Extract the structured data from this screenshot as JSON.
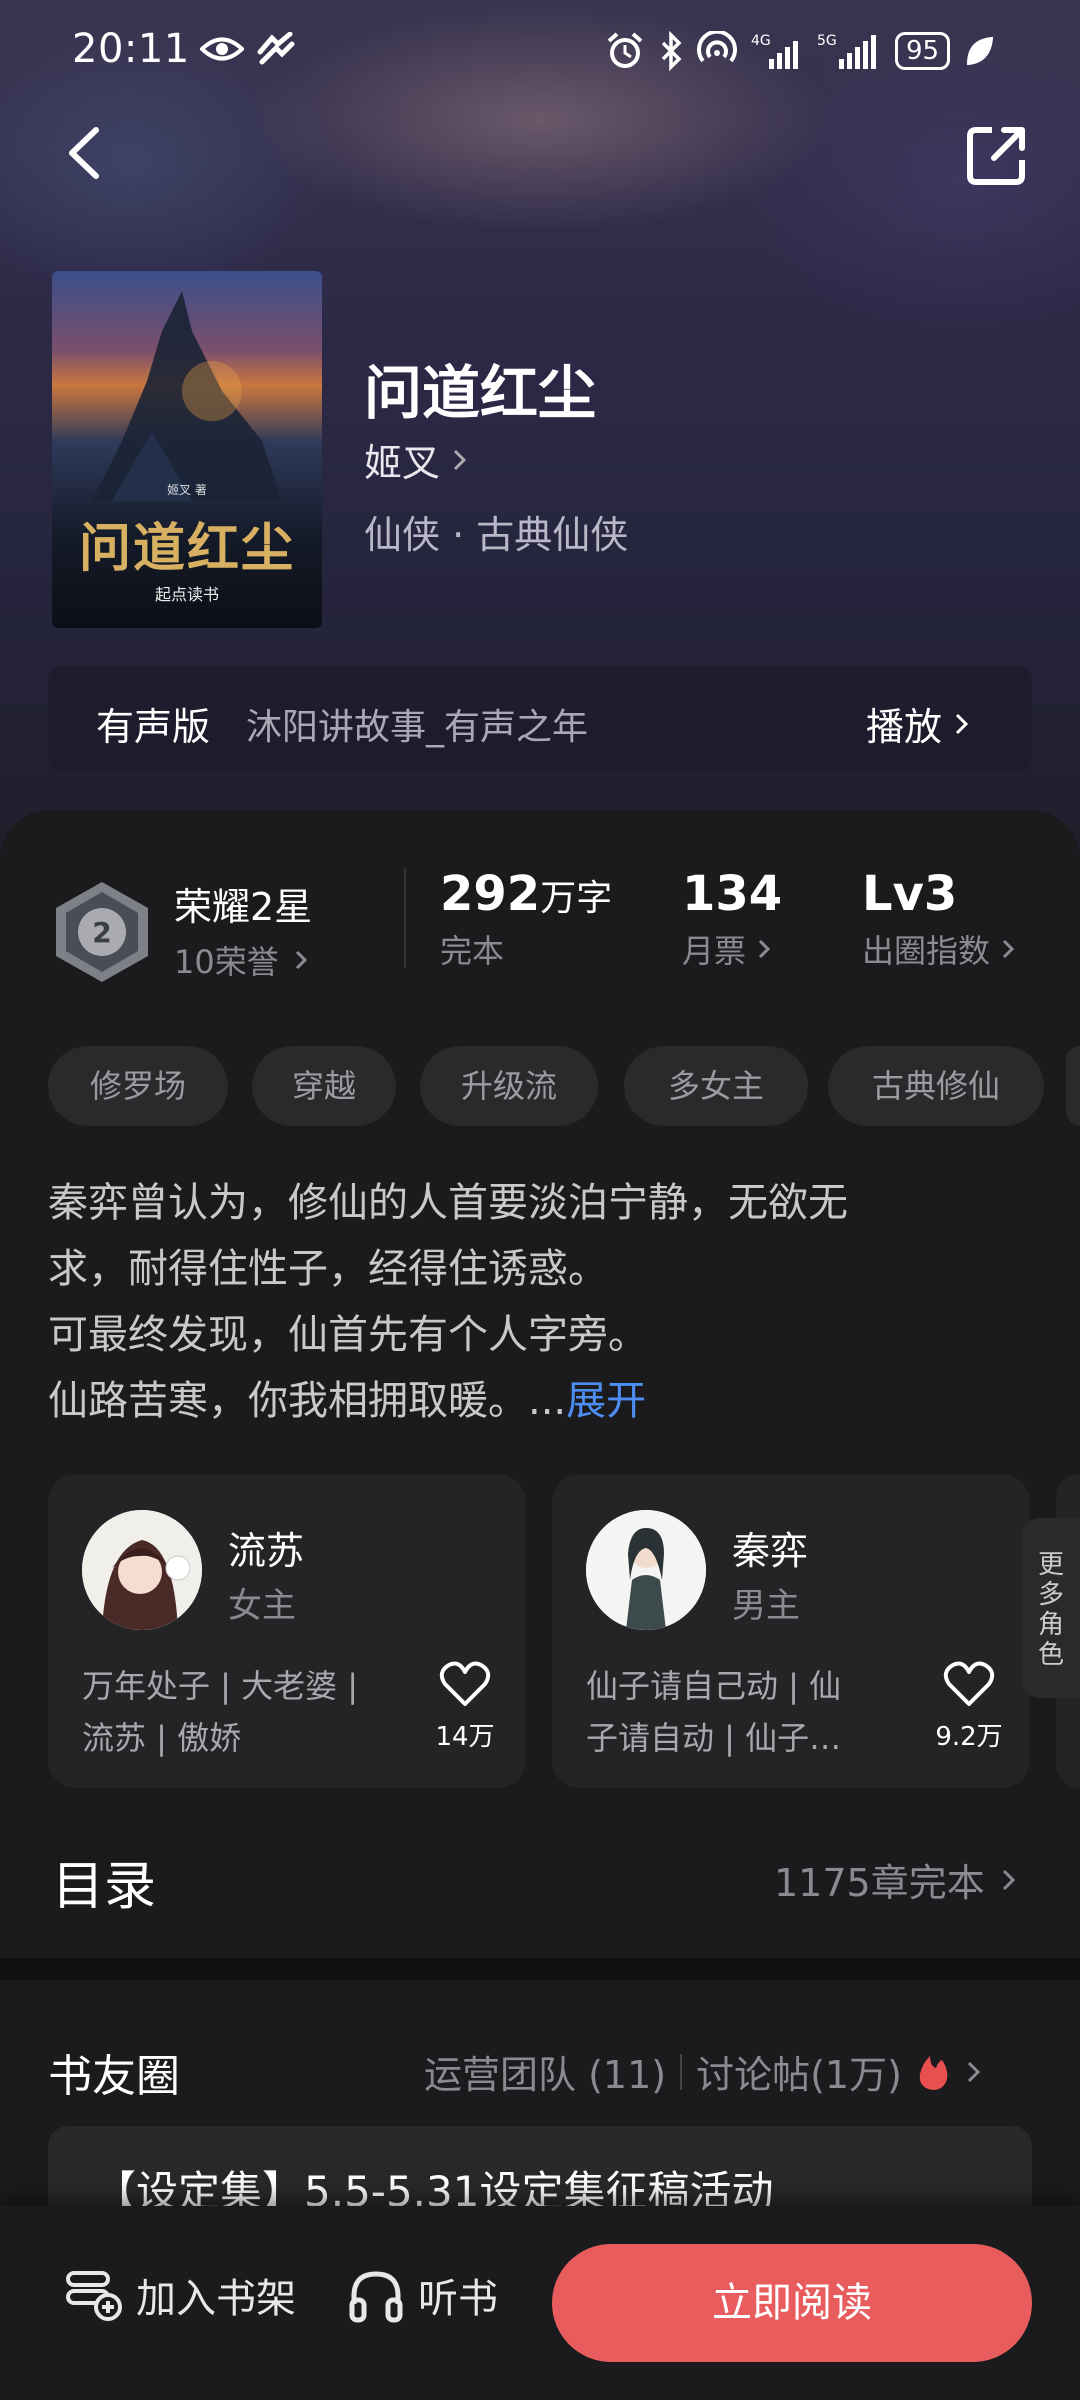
{
  "status_bar": {
    "time": "20:11",
    "battery": "95"
  },
  "book": {
    "title": "问道红尘",
    "author": "姬叉",
    "genre": "仙侠 · 古典仙侠",
    "cover_title": "问道红尘",
    "cover_author": "姬叉 著",
    "cover_brand": "起点读书"
  },
  "audio": {
    "label": "有声版",
    "narrator": "沐阳讲故事_有声之年",
    "play": "播放"
  },
  "stats": {
    "honor_title": "荣耀2星",
    "honor_sub": "10荣誉",
    "words_num": "292",
    "words_unit": "万字",
    "words_label": "完本",
    "tickets_num": "134",
    "tickets_label": "月票",
    "index_num": "Lv3",
    "index_label": "出圈指数"
  },
  "tags": [
    "修罗场",
    "穿越",
    "升级流",
    "多女主",
    "古典修仙"
  ],
  "synopsis": {
    "line1": "秦弈曾认为，修仙的人首要淡泊宁静，无欲无",
    "line2": "求，耐得住性子，经得住诱惑。",
    "line3": "可最终发现，仙首先有个人字旁。",
    "line4": "仙路苦寒，你我相拥取暖。...",
    "expand": "展开"
  },
  "characters": [
    {
      "name": "流苏",
      "role": "女主",
      "desc1": "万年处子 | 大老婆 |",
      "desc2": "流苏 | 傲娇",
      "likes": "14万"
    },
    {
      "name": "秦弈",
      "role": "男主",
      "desc1": "仙子请自己动 | 仙",
      "desc2": "子请自动 | 仙子…",
      "likes": "9.2万"
    }
  ],
  "more_roles": "更多角色",
  "toc": {
    "title": "目录",
    "info": "1175章完本"
  },
  "circle": {
    "title": "书友圈",
    "team": "运营团队 (11)",
    "posts": "讨论帖(1万)",
    "post_title": "【设定集】5.5-5.31设定集征稿活动"
  },
  "bottom": {
    "shelf": "加入书架",
    "listen": "听书",
    "read": "立即阅读"
  },
  "colors": {
    "accent": "#e85c5e",
    "link": "#4d8ef5",
    "background": "#1b1b1d"
  }
}
